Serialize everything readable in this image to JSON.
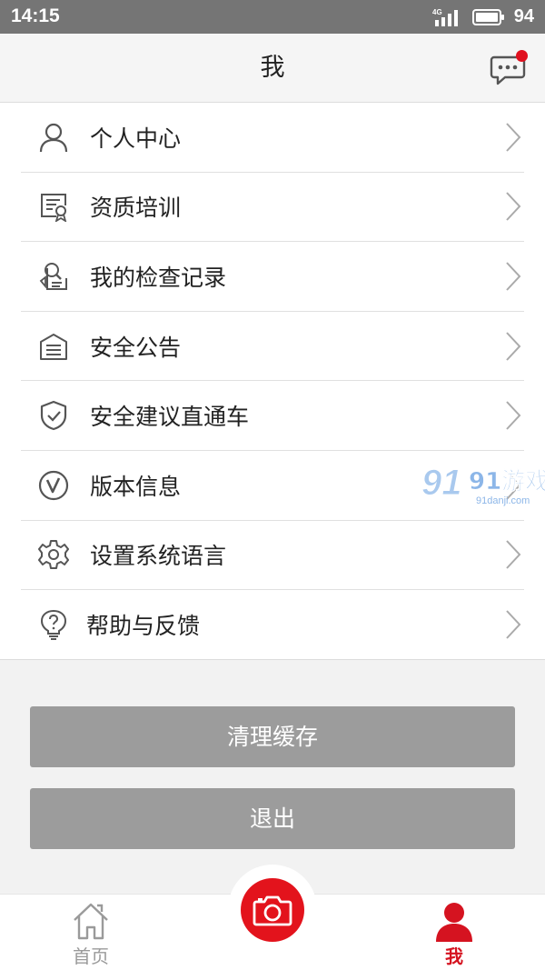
{
  "status_bar": {
    "time": "14:15",
    "network": "4G",
    "battery": "94"
  },
  "header": {
    "title": "我"
  },
  "menu": {
    "items": [
      {
        "label": "个人中心",
        "icon": "person-icon"
      },
      {
        "label": "资质培训",
        "icon": "certificate-icon"
      },
      {
        "label": "我的检查记录",
        "icon": "inspection-record-icon"
      },
      {
        "label": "安全公告",
        "icon": "announcement-icon"
      },
      {
        "label": "安全建议直通车",
        "icon": "shield-check-icon"
      },
      {
        "label": "版本信息",
        "icon": "version-icon"
      },
      {
        "label": "设置系统语言",
        "icon": "settings-gear-icon"
      },
      {
        "label": "帮助与反馈",
        "icon": "help-bulb-icon"
      }
    ]
  },
  "watermark": {
    "logo_text": "91游戏",
    "site": "91danji.com"
  },
  "buttons": {
    "clear_cache": "清理缓存",
    "logout": "退出"
  },
  "tab_bar": {
    "home_label": "首页",
    "me_label": "我",
    "camera_icon": "camera-icon"
  },
  "colors": {
    "accent_red": "#e3131c",
    "active_tab": "#d51320",
    "button_gray": "#9c9c9c",
    "status_bar": "#757575"
  }
}
